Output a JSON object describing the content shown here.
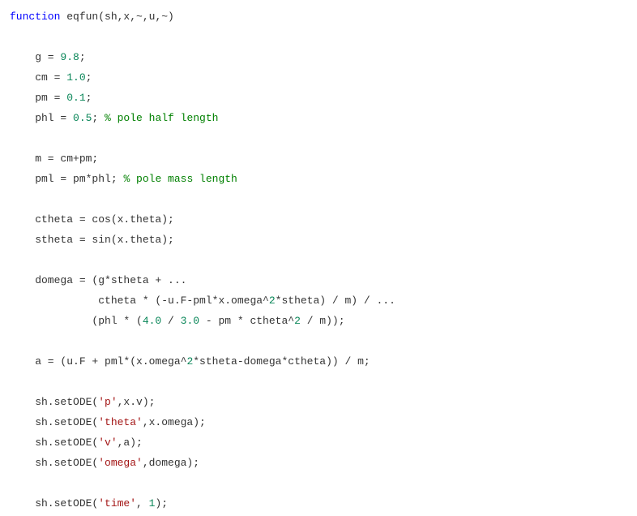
{
  "code": {
    "l01_kw": "function",
    "l01_rest": " eqfun(sh,x,~,u,~)",
    "l03_a": "    g = ",
    "l03_n": "9.8",
    "l03_b": ";",
    "l04_a": "    cm = ",
    "l04_n": "1.0",
    "l04_b": ";",
    "l05_a": "    pm = ",
    "l05_n": "0.1",
    "l05_b": ";",
    "l06_a": "    phl = ",
    "l06_n": "0.5",
    "l06_b": "; ",
    "l06_c": "% pole half length",
    "l08": "    m = cm+pm;",
    "l09_a": "    pml = pm*phl; ",
    "l09_c": "% pole mass length",
    "l11": "    ctheta = cos(x.theta);",
    "l12": "    stheta = sin(x.theta);",
    "l14": "    domega = (g*stheta + ...",
    "l15_a": "              ctheta * (-u.F-pml*x.omega^",
    "l15_n": "2",
    "l15_b": "*stheta) / m) / ...",
    "l16_a": "             (phl * (",
    "l16_n1": "4.0",
    "l16_b": " / ",
    "l16_n2": "3.0",
    "l16_c": " - pm * ctheta^",
    "l16_n3": "2",
    "l16_d": " / m));",
    "l18_a": "    a = (u.F + pml*(x.omega^",
    "l18_n": "2",
    "l18_b": "*stheta-domega*ctheta)) / m;",
    "l20_a": "    sh.setODE(",
    "l20_s": "'p'",
    "l20_b": ",x.v);",
    "l21_a": "    sh.setODE(",
    "l21_s": "'theta'",
    "l21_b": ",x.omega);",
    "l22_a": "    sh.setODE(",
    "l22_s": "'v'",
    "l22_b": ",a);",
    "l23_a": "    sh.setODE(",
    "l23_s": "'omega'",
    "l23_b": ",domega);",
    "l25_a": "    sh.setODE(",
    "l25_s": "'time'",
    "l25_b": ", ",
    "l25_n": "1",
    "l25_c": ");"
  }
}
